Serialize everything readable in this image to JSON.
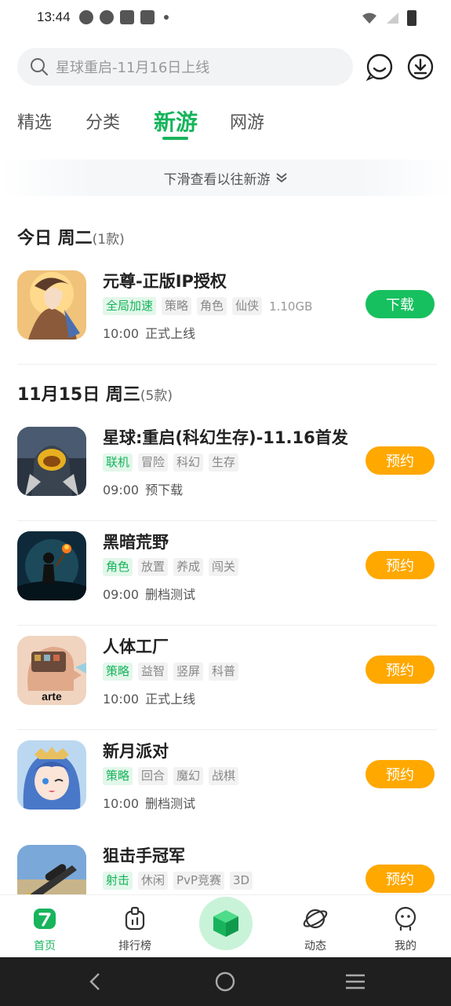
{
  "status_bar": {
    "time": "13:44"
  },
  "search": {
    "placeholder": "星球重启-11月16日上线"
  },
  "tabs": [
    {
      "label": "精选",
      "active": false
    },
    {
      "label": "分类",
      "active": false
    },
    {
      "label": "新游",
      "active": true
    },
    {
      "label": "网游",
      "active": false
    }
  ],
  "hint": {
    "text": "下滑查看以往新游"
  },
  "sections": [
    {
      "title": "今日 周二",
      "count": "(1款)",
      "games": [
        {
          "name": "元尊-正版IP授权",
          "tags": [
            "全局加速",
            "策略",
            "角色",
            "仙侠"
          ],
          "size": "1.10GB",
          "time": "10:00",
          "status": "正式上线",
          "button": "下载"
        }
      ]
    },
    {
      "title": "11月15日 周三",
      "count": "(5款)",
      "games": [
        {
          "name": "星球:重启(科幻生存)-11.16首发",
          "tags": [
            "联机",
            "冒险",
            "科幻",
            "生存"
          ],
          "time": "09:00",
          "status": "预下载",
          "button": "预约"
        },
        {
          "name": "黑暗荒野",
          "tags": [
            "角色",
            "放置",
            "养成",
            "闯关"
          ],
          "time": "09:00",
          "status": "删档测试",
          "button": "预约"
        },
        {
          "name": "人体工厂",
          "tags": [
            "策略",
            "益智",
            "竖屏",
            "科普"
          ],
          "time": "10:00",
          "status": "正式上线",
          "button": "预约"
        },
        {
          "name": "新月派对",
          "tags": [
            "策略",
            "回合",
            "魔幻",
            "战棋"
          ],
          "time": "10:00",
          "status": "删档测试",
          "button": "预约"
        },
        {
          "name": "狙击手冠军",
          "tags": [
            "射击",
            "休闲",
            "PvP竞赛",
            "3D"
          ],
          "time": "",
          "status": "",
          "button": "预约"
        }
      ]
    }
  ],
  "icon_texts": {
    "arte": "arte"
  },
  "bottom_nav": [
    {
      "label": "首页",
      "icon": "home-icon"
    },
    {
      "label": "排行榜",
      "icon": "ranking-icon"
    },
    {
      "label": "",
      "icon": "game-cube-icon"
    },
    {
      "label": "动态",
      "icon": "planet-icon"
    },
    {
      "label": "我的",
      "icon": "profile-icon"
    }
  ],
  "colors": {
    "accent": "#17b45c",
    "download": "#17c05e",
    "reserve": "#ffa800"
  }
}
